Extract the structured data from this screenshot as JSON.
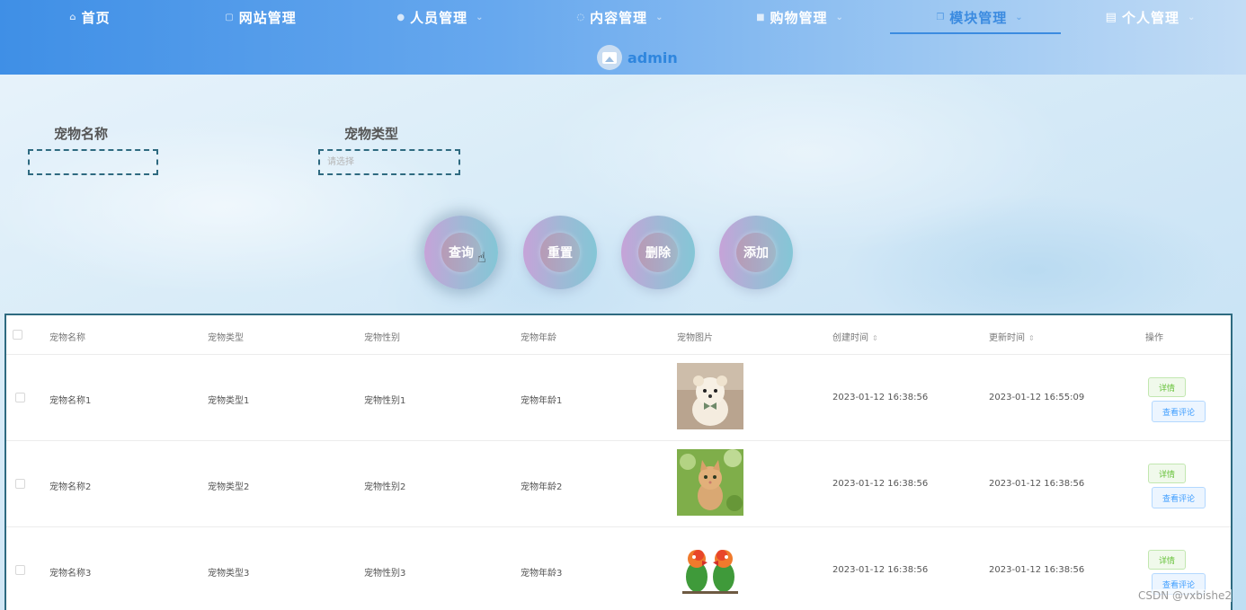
{
  "nav": {
    "items": [
      {
        "label": "首页",
        "icon": "home-icon"
      },
      {
        "label": "网站管理",
        "icon": "window-icon"
      },
      {
        "label": "人员管理",
        "icon": "user-icon"
      },
      {
        "label": "内容管理",
        "icon": "chat-icon"
      },
      {
        "label": "购物管理",
        "icon": "lock-icon"
      },
      {
        "label": "模块管理",
        "icon": "copy-icon"
      },
      {
        "label": "个人管理",
        "icon": "doc-icon"
      }
    ],
    "active": "模块管理",
    "username": "admin"
  },
  "search": {
    "name_label": "宠物名称",
    "name_value": "",
    "type_label": "宠物类型",
    "type_placeholder": "请选择"
  },
  "buttons": {
    "query": "查询",
    "reset": "重置",
    "delete": "删除",
    "add": "添加"
  },
  "table": {
    "headers": [
      "宠物名称",
      "宠物类型",
      "宠物性别",
      "宠物年龄",
      "宠物图片",
      "创建时间",
      "更新时间",
      "操作"
    ],
    "rows": [
      {
        "name": "宠物名称1",
        "type": "宠物类型1",
        "gender": "宠物性别1",
        "age": "宠物年龄1",
        "image": "puppy-photo",
        "created": "2023-01-12 16:38:56",
        "updated": "2023-01-12 16:55:09"
      },
      {
        "name": "宠物名称2",
        "type": "宠物类型2",
        "gender": "宠物性别2",
        "age": "宠物年龄2",
        "image": "kitten-photo",
        "created": "2023-01-12 16:38:56",
        "updated": "2023-01-12 16:38:56"
      },
      {
        "name": "宠物名称3",
        "type": "宠物类型3",
        "gender": "宠物性别3",
        "age": "宠物年龄3",
        "image": "parrots-photo",
        "created": "2023-01-12 16:38:56",
        "updated": "2023-01-12 16:38:56"
      }
    ],
    "detail_label": "详情",
    "comment_label": "查看评论"
  },
  "watermark": "CSDN @vxbishe2",
  "colors": {
    "accent": "#3b8be0",
    "border": "#2e6a80",
    "detail_green": "#67c23a",
    "comment_blue": "#409eff"
  }
}
